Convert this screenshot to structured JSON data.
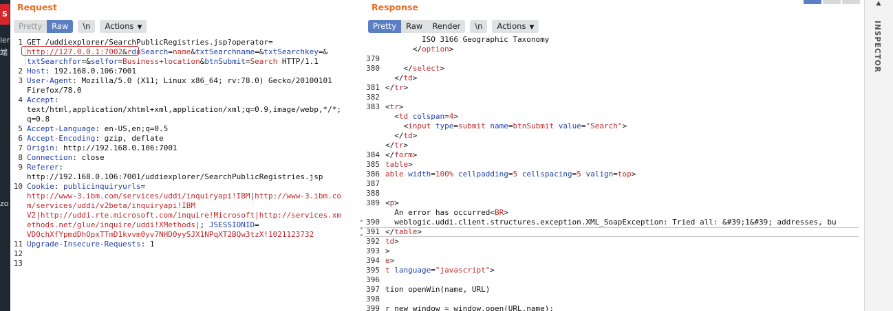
{
  "left_edge": {
    "tab_glyph": "S",
    "fragments": [
      "ier",
      "端",
      "zo"
    ]
  },
  "request": {
    "title": "Request",
    "tabs": [
      {
        "label": "Pretty",
        "state": "disabled"
      },
      {
        "label": "Raw",
        "state": "active"
      }
    ],
    "newline_button": "\\n",
    "actions_label": "Actions",
    "lines": [
      {
        "num": "1",
        "segments": [
          [
            "k-black",
            "GET /uddiexplorer/SearchPublicRegistries.jsp?operator="
          ]
        ]
      },
      {
        "num": "",
        "segments": [
          [
            "k-red",
            "http://127.0.0.1:7002"
          ],
          [
            "k-black",
            "&"
          ],
          [
            "k-red",
            "r"
          ],
          [
            "k-blue",
            "doSearch"
          ],
          [
            "k-black",
            "="
          ],
          [
            "k-red",
            "name"
          ],
          [
            "k-black",
            "&"
          ],
          [
            "k-blue",
            "txtSearchname"
          ],
          [
            "k-black",
            "=&"
          ],
          [
            "k-blue",
            "txtSearchkey"
          ],
          [
            "k-black",
            "=&"
          ]
        ]
      },
      {
        "num": "",
        "segments": [
          [
            "k-blue",
            "txtSearchfor"
          ],
          [
            "k-black",
            "=&"
          ],
          [
            "k-blue",
            "selfor"
          ],
          [
            "k-black",
            "="
          ],
          [
            "k-red",
            "Business+location"
          ],
          [
            "k-black",
            "&"
          ],
          [
            "k-blue",
            "btnSubmit"
          ],
          [
            "k-black",
            "="
          ],
          [
            "k-red",
            "Search"
          ],
          [
            "k-black",
            " HTTP/1.1"
          ]
        ]
      },
      {
        "num": "2",
        "segments": [
          [
            "k-blue",
            "Host"
          ],
          [
            "k-black",
            ": 192.168.0.106:7001"
          ]
        ]
      },
      {
        "num": "3",
        "segments": [
          [
            "k-blue",
            "User-Agent"
          ],
          [
            "k-black",
            ": Mozilla/5.0 (X11; Linux x86_64; rv:78.0) Gecko/20100101"
          ]
        ]
      },
      {
        "num": "",
        "segments": [
          [
            "k-black",
            "Firefox/78.0"
          ]
        ]
      },
      {
        "num": "4",
        "segments": [
          [
            "k-blue",
            "Accept"
          ],
          [
            "k-black",
            ":"
          ]
        ]
      },
      {
        "num": "",
        "segments": [
          [
            "k-black",
            "text/html,application/xhtml+xml,application/xml;q=0.9,image/webp,*/*;"
          ]
        ]
      },
      {
        "num": "",
        "segments": [
          [
            "k-black",
            "q=0.8"
          ]
        ]
      },
      {
        "num": "5",
        "segments": [
          [
            "k-blue",
            "Accept-Language"
          ],
          [
            "k-black",
            ": en-US,en;q=0.5"
          ]
        ]
      },
      {
        "num": "6",
        "segments": [
          [
            "k-blue",
            "Accept-Encoding"
          ],
          [
            "k-black",
            ": gzip, deflate"
          ]
        ]
      },
      {
        "num": "7",
        "segments": [
          [
            "k-blue",
            "Origin"
          ],
          [
            "k-black",
            ": http://192.168.0.106:7001"
          ]
        ]
      },
      {
        "num": "8",
        "segments": [
          [
            "k-blue",
            "Connection"
          ],
          [
            "k-black",
            ": close"
          ]
        ]
      },
      {
        "num": "9",
        "segments": [
          [
            "k-blue",
            "Referer"
          ],
          [
            "k-black",
            ":"
          ]
        ]
      },
      {
        "num": "",
        "segments": [
          [
            "k-black",
            "http://192.168.0.106:7001/uddiexplorer/SearchPublicRegistries.jsp"
          ]
        ]
      },
      {
        "num": "10",
        "segments": [
          [
            "k-blue",
            "Cookie"
          ],
          [
            "k-black",
            ": "
          ],
          [
            "k-blue",
            "publicinquiryurls"
          ],
          [
            "k-black",
            "="
          ]
        ]
      },
      {
        "num": "",
        "segments": [
          [
            "k-red",
            "http://www-3.ibm.com/services/uddi/inquiryapi!IBM|http://www-3.ibm.co"
          ]
        ]
      },
      {
        "num": "",
        "segments": [
          [
            "k-red",
            "m/services/uddi/v2beta/inquiryapi!IBM"
          ]
        ]
      },
      {
        "num": "",
        "segments": [
          [
            "k-red",
            "V2|http://uddi.rte.microsoft.com/inquire!Microsoft|http://services.xm"
          ]
        ]
      },
      {
        "num": "",
        "segments": [
          [
            "k-red",
            "ethods.net/glue/inquire/uddi!XMethods|"
          ],
          [
            "k-black",
            "; "
          ],
          [
            "k-blue",
            "JSESSIONID"
          ],
          [
            "k-black",
            "="
          ]
        ]
      },
      {
        "num": "",
        "segments": [
          [
            "k-red",
            "VD0chXfYpmdDhOpxTTmD1kvvm0yv7NHD0yySJX1NPqXT2BQw3tzX!1021123732"
          ]
        ]
      },
      {
        "num": "11",
        "segments": [
          [
            "k-blue",
            "Upgrade-Insecure-Requests"
          ],
          [
            "k-black",
            ": 1"
          ]
        ]
      },
      {
        "num": "12",
        "segments": []
      },
      {
        "num": "13",
        "segments": []
      }
    ]
  },
  "response": {
    "title": "Response",
    "tabs": [
      {
        "label": "Pretty",
        "state": "active"
      },
      {
        "label": "Raw",
        "state": "normal"
      },
      {
        "label": "Render",
        "state": "normal"
      }
    ],
    "newline_button": "\\n",
    "actions_label": "Actions",
    "lines": [
      {
        "num": "",
        "segments": [
          [
            "k-black",
            "        ISO 3166 Geographic Taxonomy"
          ]
        ]
      },
      {
        "num": "",
        "segments": [
          [
            "k-black",
            "      </"
          ],
          [
            "k-red",
            "option"
          ],
          [
            "k-black",
            ">"
          ]
        ]
      },
      {
        "num": "379",
        "segments": []
      },
      {
        "num": "380",
        "segments": [
          [
            "k-black",
            "    </"
          ],
          [
            "k-red",
            "select"
          ],
          [
            "k-black",
            ">"
          ]
        ]
      },
      {
        "num": "",
        "segments": [
          [
            "k-black",
            "  </"
          ],
          [
            "k-red",
            "td"
          ],
          [
            "k-black",
            ">"
          ]
        ]
      },
      {
        "num": "381",
        "segments": [
          [
            "k-black",
            "</"
          ],
          [
            "k-red",
            "tr"
          ],
          [
            "k-black",
            ">"
          ]
        ]
      },
      {
        "num": "382",
        "segments": []
      },
      {
        "num": "383",
        "segments": [
          [
            "k-black",
            "<"
          ],
          [
            "k-red",
            "tr"
          ],
          [
            "k-black",
            ">"
          ]
        ]
      },
      {
        "num": "",
        "segments": [
          [
            "k-black",
            "  <"
          ],
          [
            "k-red",
            "td "
          ],
          [
            "k-blue",
            "colspan"
          ],
          [
            "k-black",
            "="
          ],
          [
            "k-red",
            "4"
          ],
          [
            "k-black",
            ">"
          ]
        ]
      },
      {
        "num": "",
        "segments": [
          [
            "k-black",
            "    <"
          ],
          [
            "k-red",
            "input "
          ],
          [
            "k-blue",
            "type"
          ],
          [
            "k-black",
            "="
          ],
          [
            "k-red",
            "submit "
          ],
          [
            "k-blue",
            "name"
          ],
          [
            "k-black",
            "="
          ],
          [
            "k-red",
            "btnSubmit "
          ],
          [
            "k-blue",
            "value"
          ],
          [
            "k-black",
            "="
          ],
          [
            "k-red",
            "\"Search\""
          ],
          [
            "k-black",
            ">"
          ]
        ]
      },
      {
        "num": "",
        "segments": [
          [
            "k-black",
            "  </"
          ],
          [
            "k-red",
            "td"
          ],
          [
            "k-black",
            ">"
          ]
        ]
      },
      {
        "num": "",
        "segments": [
          [
            "k-black",
            "</"
          ],
          [
            "k-red",
            "tr"
          ],
          [
            "k-black",
            ">"
          ]
        ]
      },
      {
        "num": "384",
        "segments": [
          [
            "k-black",
            "</"
          ],
          [
            "k-red",
            "form"
          ],
          [
            "k-black",
            ">"
          ]
        ]
      },
      {
        "num": "385",
        "segments": [
          [
            "k-red",
            "table"
          ],
          [
            "k-black",
            ">"
          ]
        ]
      },
      {
        "num": "386",
        "segments": [
          [
            "k-red",
            "able "
          ],
          [
            "k-blue",
            "width"
          ],
          [
            "k-black",
            "="
          ],
          [
            "k-red",
            "100% "
          ],
          [
            "k-blue",
            "cellpadding"
          ],
          [
            "k-black",
            "="
          ],
          [
            "k-red",
            "5 "
          ],
          [
            "k-blue",
            "cellspacing"
          ],
          [
            "k-black",
            "="
          ],
          [
            "k-red",
            "5 "
          ],
          [
            "k-blue",
            "valign"
          ],
          [
            "k-black",
            "="
          ],
          [
            "k-red",
            "top"
          ],
          [
            "k-black",
            ">"
          ]
        ]
      },
      {
        "num": "387",
        "segments": []
      },
      {
        "num": "388",
        "segments": []
      },
      {
        "num": "389",
        "segments": [
          [
            "k-black",
            "<"
          ],
          [
            "k-red",
            "p"
          ],
          [
            "k-black",
            ">"
          ]
        ]
      },
      {
        "num": "",
        "segments": [
          [
            "k-black",
            "  An error has occurred<"
          ],
          [
            "k-red",
            "BR"
          ],
          [
            "k-black",
            ">"
          ]
        ]
      },
      {
        "num": "390",
        "segments": [
          [
            "k-black",
            "  weblogic.uddi.client.structures.exception.XML_SoapException: Tried all: &#39;1&#39; addresses, bu"
          ]
        ]
      },
      {
        "num": "391",
        "segments": [
          [
            "k-black",
            "</"
          ],
          [
            "k-red",
            "table"
          ],
          [
            "k-black",
            ">"
          ]
        ]
      },
      {
        "num": "392",
        "segments": [
          [
            "k-red",
            "td"
          ],
          [
            "k-black",
            ">"
          ]
        ]
      },
      {
        "num": "393",
        "segments": [
          [
            "k-black",
            ">"
          ]
        ]
      },
      {
        "num": "394",
        "segments": [
          [
            "k-red",
            "e"
          ],
          [
            "k-black",
            ">"
          ]
        ]
      },
      {
        "num": "395",
        "segments": [
          [
            "k-red",
            "t "
          ],
          [
            "k-blue",
            "language"
          ],
          [
            "k-black",
            "="
          ],
          [
            "k-red",
            "\"javascript\""
          ],
          [
            "k-black",
            ">"
          ]
        ]
      },
      {
        "num": "396",
        "segments": []
      },
      {
        "num": "397",
        "segments": [
          [
            "k-black",
            "tion openWin(name, URL)"
          ]
        ]
      },
      {
        "num": "398",
        "segments": []
      },
      {
        "num": "399",
        "segments": [
          [
            "k-black",
            "r new window = window.open(URL,name);"
          ]
        ]
      }
    ]
  },
  "inspector": {
    "label": "INSPECTOR"
  }
}
